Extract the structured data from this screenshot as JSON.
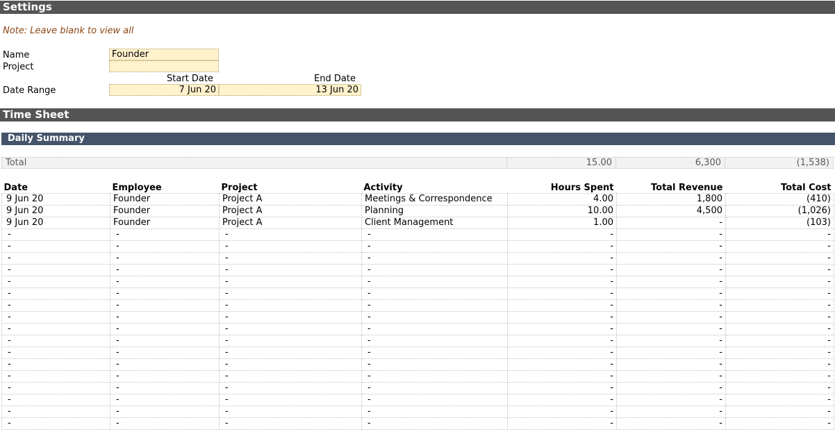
{
  "settings": {
    "title": "Settings",
    "note": "Note: Leave blank to view all",
    "name_label": "Name",
    "name_value": "Founder",
    "project_label": "Project",
    "project_value": "",
    "start_date_label": "Start Date",
    "end_date_label": "End Date",
    "date_range_label": "Date Range",
    "start_date_value": "7 Jun 20",
    "end_date_value": "13 Jun 20",
    "input_color": "#fff2cc"
  },
  "timesheet": {
    "title": "Time Sheet",
    "daily_summary_title": "Daily Summary",
    "total": {
      "label": "Total",
      "hours": "15.00",
      "revenue": "6,300",
      "cost": "(1,538)"
    },
    "columns": [
      "Date",
      "Employee",
      "Project",
      "Activity",
      "Hours Spent",
      "Total Revenue",
      "Total Cost"
    ],
    "rows": [
      [
        "9 Jun 20",
        "Founder",
        "Project A",
        "Meetings & Correspondence",
        "4.00",
        "1,800",
        "(410)"
      ],
      [
        "9 Jun 20",
        "Founder",
        "Project A",
        "Planning",
        "10.00",
        "4,500",
        "(1,026)"
      ],
      [
        "9 Jun 20",
        "Founder",
        "Project A",
        "Client Management",
        "1.00",
        "-",
        "(103)"
      ]
    ],
    "empty_value": "-",
    "empty_row_count": 17
  },
  "colors": {
    "section_bar": "#555555",
    "sub_bar": "#44546a",
    "note_text": "#8b4513"
  }
}
